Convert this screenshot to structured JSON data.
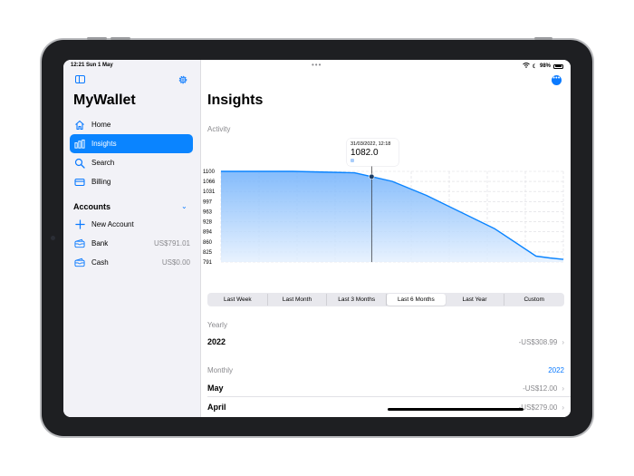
{
  "colors": {
    "accent": "#0a84ff",
    "chart_fill_top": "#6fb0fb",
    "chart_fill_bottom": "#e4f0fe"
  },
  "status_bar": {
    "time_date": "12:21  Sun 1 May",
    "battery": "98%"
  },
  "sidebar": {
    "app_title": "MyWallet",
    "nav": [
      {
        "label": "Home",
        "icon": "house-icon",
        "active": false
      },
      {
        "label": "Insights",
        "icon": "chart-bar-icon",
        "active": true
      },
      {
        "label": "Search",
        "icon": "magnifying-glass-icon",
        "active": false
      },
      {
        "label": "Billing",
        "icon": "credit-card-icon",
        "active": false
      }
    ],
    "accounts_title": "Accounts",
    "new_account_label": "New Account",
    "accounts": [
      {
        "name": "Bank",
        "amount": "US$791.01",
        "icon": "wallet-icon"
      },
      {
        "name": "Cash",
        "amount": "US$0.00",
        "icon": "wallet-icon"
      }
    ]
  },
  "main": {
    "title": "Insights",
    "activity_label": "Activity",
    "tooltip": {
      "date": "31/03/2022, 12:18",
      "value": "1082.0"
    },
    "ranges": [
      "Last Week",
      "Last Month",
      "Last 3 Months",
      "Last 6 Months",
      "Last Year",
      "Custom"
    ],
    "selected_range": "Last 6 Months",
    "yearly_label": "Yearly",
    "yearly": [
      {
        "label": "2022",
        "value": "-US$308.99"
      }
    ],
    "monthly_label": "Monthly",
    "monthly_year": "2022",
    "monthly": [
      {
        "label": "May",
        "value": "-US$12.00"
      },
      {
        "label": "April",
        "value": "-US$279.00"
      }
    ]
  },
  "chart_data": {
    "type": "area",
    "y_ticks": [
      "1100",
      "1066",
      "1031",
      "997",
      "963",
      "928",
      "894",
      "860",
      "825",
      "791"
    ],
    "ylim": [
      791,
      1100
    ],
    "series": [
      {
        "values": [
          1100,
          1100,
          1100,
          1095,
          1082,
          1066,
          1018,
          904,
          811,
          805,
          800
        ]
      }
    ],
    "x_positions": [
      0,
      0.21,
      0.21,
      0.39,
      0.44,
      0.5,
      0.6,
      0.8,
      0.92,
      0.96,
      1.0
    ],
    "selected_index": 4,
    "grid": true
  }
}
